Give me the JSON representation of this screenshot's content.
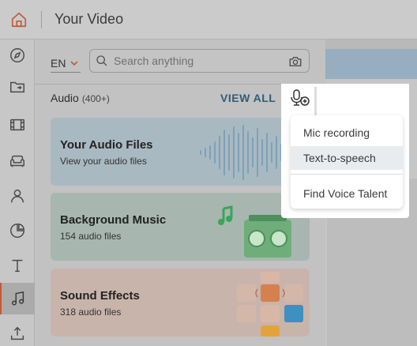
{
  "header": {
    "title": "Your Video"
  },
  "rail": {
    "items": [
      "compass",
      "folder-import",
      "film",
      "sofa",
      "person",
      "pie-chart",
      "text",
      "music",
      "upload"
    ]
  },
  "panel": {
    "language": "EN",
    "search": {
      "placeholder": "Search anything"
    },
    "section": {
      "title": "Audio",
      "count": "(400+)",
      "view_all": "VIEW ALL"
    },
    "cards": [
      {
        "title": "Your Audio Files",
        "subtitle": "View your audio files"
      },
      {
        "title": "Background Music",
        "subtitle": "154 audio files"
      },
      {
        "title": "Sound Effects",
        "subtitle": "318 audio files"
      }
    ]
  },
  "mic_menu": {
    "items": [
      {
        "label": "Mic recording"
      },
      {
        "label": "Text-to-speech"
      },
      {
        "label": "Find Voice Talent"
      }
    ]
  },
  "colors": {
    "accent": "#c05a3a",
    "view_all": "#2f5e77"
  }
}
